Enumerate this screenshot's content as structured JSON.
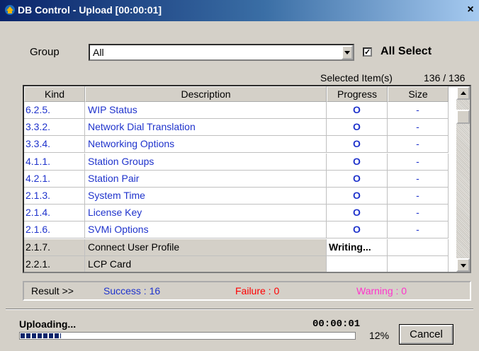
{
  "window": {
    "title": "DB Control - Upload [00:00:01]",
    "close_glyph": "×"
  },
  "filter": {
    "group_label": "Group",
    "group_value": "All",
    "all_select_label": "All Select",
    "all_select_checked": true
  },
  "selection": {
    "label": "Selected Item(s)",
    "count": "136 / 136"
  },
  "table": {
    "headers": {
      "kind": "Kind",
      "description": "Description",
      "progress": "Progress",
      "size": "Size"
    },
    "rows": [
      {
        "kind": "6.2.5.",
        "description": "WIP Status",
        "progress": "O",
        "size": "-",
        "done": true
      },
      {
        "kind": "3.3.2.",
        "description": "Network Dial Translation",
        "progress": "O",
        "size": "-",
        "done": true
      },
      {
        "kind": "3.3.4.",
        "description": "Networking Options",
        "progress": "O",
        "size": "-",
        "done": true
      },
      {
        "kind": "4.1.1.",
        "description": "Station Groups",
        "progress": "O",
        "size": "-",
        "done": true
      },
      {
        "kind": "4.2.1.",
        "description": "Station Pair",
        "progress": "O",
        "size": "-",
        "done": true
      },
      {
        "kind": "2.1.3.",
        "description": "System Time",
        "progress": "O",
        "size": "-",
        "done": true
      },
      {
        "kind": "2.1.4.",
        "description": "License Key",
        "progress": "O",
        "size": "-",
        "done": true
      },
      {
        "kind": "2.1.6.",
        "description": "SVMi Options",
        "progress": "O",
        "size": "-",
        "done": true
      },
      {
        "kind": "2.1.7.",
        "description": "Connect User Profile",
        "progress": "Writing...",
        "size": "",
        "done": false
      },
      {
        "kind": "2.2.1.",
        "description": "LCP Card",
        "progress": "",
        "size": "",
        "done": false
      }
    ]
  },
  "result": {
    "label": "Result >>",
    "success": "Success : 16",
    "failure": "Failure : 0",
    "warning": "Warning : 0"
  },
  "status": {
    "label": "Uploading...",
    "timer": "00:00:01",
    "percent": "12%",
    "progress_fraction": 0.12,
    "cancel_label": "Cancel"
  },
  "colors": {
    "done_text": "#1f33cc",
    "failure": "#ff0000",
    "warning": "#ff33cc",
    "progress_fill": "#0a246a"
  }
}
